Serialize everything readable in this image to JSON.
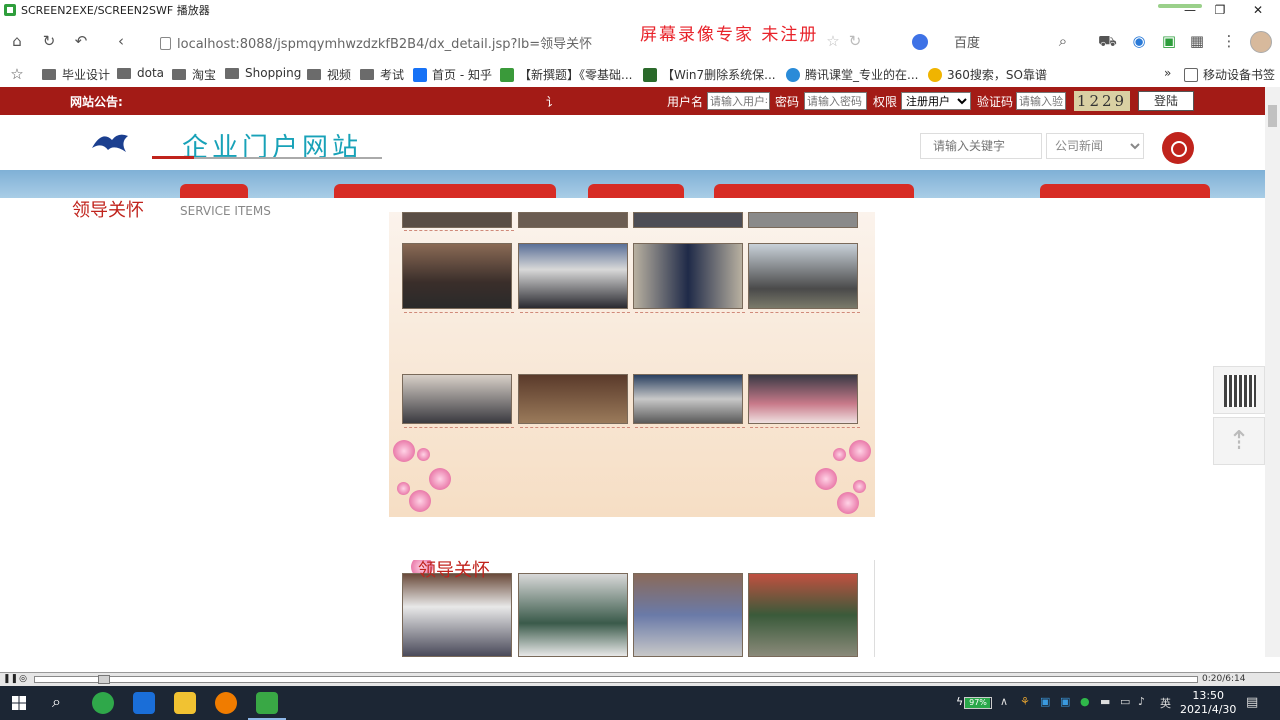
{
  "player": {
    "window_title": "SCREEN2EXE/SCREEN2SWF 播放器",
    "watermark": "屏幕录像专家  未注册",
    "time": "0:20/6:14"
  },
  "browser": {
    "url": "localhost:8088/jspmqymhwzdzkfB2B4/dx_detail.jsp?lb=领导关怀",
    "search_engine": "百度",
    "bookmarks": [
      "毕业设计",
      "dota",
      "淘宝",
      "Shopping",
      "视频",
      "考试",
      "首页 - 知乎",
      "【新撰题】《零基础...",
      "【Win7删除系统保...",
      "腾讯课堂_专业的在...",
      "360搜索，SO靠谱",
      "移动设备书签"
    ],
    "more_bookmarks": "»"
  },
  "site": {
    "notice_label": "网站公告:",
    "notice_text": "讠",
    "login": {
      "username_label": "用户名",
      "username_placeholder": "请输入用户名",
      "password_label": "密码",
      "password_placeholder": "请输入密码",
      "role_label": "权限",
      "role_value": "注册用户",
      "captcha_label": "验证码",
      "captcha_placeholder": "请输入验",
      "captcha_code": "1229",
      "submit_label": "登陆"
    },
    "logo_text": "企业门户网站",
    "search": {
      "keyword_placeholder": "请输入关键字",
      "category_value": "公司新闻"
    },
    "section_title": "领导关怀",
    "section_subtitle": "SERVICE ITEMS",
    "section2_title": "领导关怀"
  },
  "taskbar": {
    "battery": "97%",
    "battery_fraction": 0.97,
    "ime": "英",
    "time": "13:50",
    "date": "2021/4/30"
  }
}
